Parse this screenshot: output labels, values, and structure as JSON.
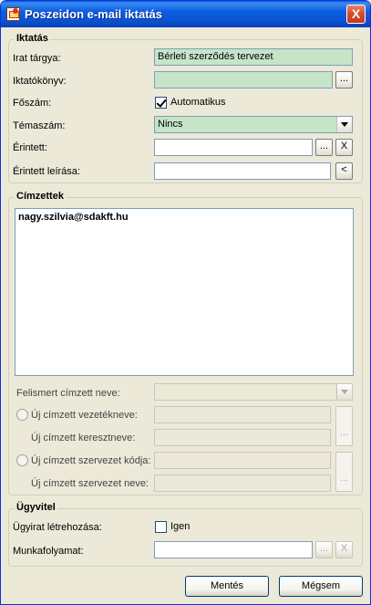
{
  "window": {
    "title": "Poszeidon e-mail iktatás",
    "close_label": "X"
  },
  "iktatas": {
    "group_title": "Iktatás",
    "irat_targya_label": "Irat tárgya:",
    "irat_targya_value": "Bérleti szerződés tervezet",
    "iktatokonyv_label": "Iktatókönyv:",
    "iktatokonyv_value": "",
    "foszam_label": "Főszám:",
    "foszam_checkbox_label": "Automatikus",
    "foszam_checked": true,
    "temaszam_label": "Témaszám:",
    "temaszam_value": "Nincs",
    "erintett_label": "Érintett:",
    "erintett_value": "",
    "erintett_leirasa_label": "Érintett leírása:",
    "erintett_leirasa_value": "",
    "browse_label": "...",
    "clear_label": "X",
    "back_label": "<"
  },
  "cimzettek": {
    "group_title": "Címzettek",
    "recipients": [
      "nagy.szilvia@sdakft.hu"
    ],
    "felismert_label": "Felismert címzett neve:",
    "felismert_value": "",
    "uj_vezeteknev_label": "Új címzett vezetékneve:",
    "uj_keresztnev_label": "Új címzett keresztneve:",
    "uj_szervezet_kod_label": "Új címzett szervezet kódja:",
    "uj_szervezet_nev_label": "Új címzett szervezet neve:",
    "browse_label": "..."
  },
  "ugyvitel": {
    "group_title": "Ügyvitel",
    "ugyirat_label": "Ügyirat létrehozása:",
    "ugyirat_checkbox_label": "Igen",
    "ugyirat_checked": false,
    "munkafolyamat_label": "Munkafolyamat:",
    "munkafolyamat_value": "",
    "browse_label": "...",
    "clear_label": "X"
  },
  "buttons": {
    "save": "Mentés",
    "cancel": "Mégsem"
  }
}
